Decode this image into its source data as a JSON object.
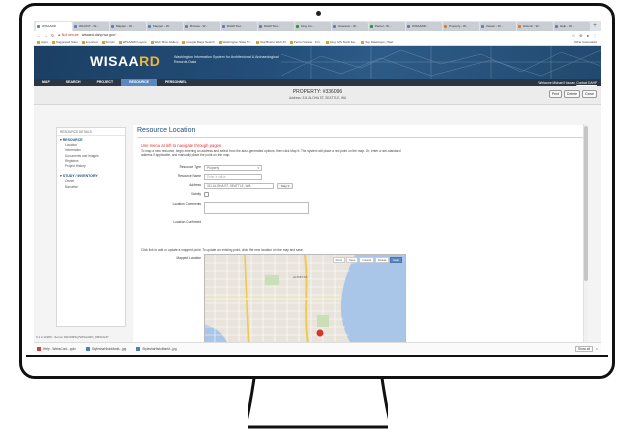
{
  "browser": {
    "tabs": [
      {
        "label": "WISAARD",
        "style": "active"
      },
      {
        "label": "WA DOT - W...",
        "style": ""
      },
      {
        "label": "Mapper - W...",
        "style": ""
      },
      {
        "label": "Mapper - W...",
        "style": ""
      },
      {
        "label": "Browse - W...",
        "style": ""
      },
      {
        "label": "DAHP Det...",
        "style": ""
      },
      {
        "label": "DAHP Det...",
        "style": ""
      },
      {
        "label": "King Co...",
        "style": "green"
      },
      {
        "label": "Assessor - W...",
        "style": ""
      },
      {
        "label": "Parcel - W...",
        "style": "green"
      },
      {
        "label": "WISAARD...",
        "style": ""
      },
      {
        "label": "Property - W...",
        "style": "orange"
      },
      {
        "label": "Viewer - W...",
        "style": ""
      },
      {
        "label": "Historic - W...",
        "style": "orange"
      },
      {
        "label": "Help - W...",
        "style": ""
      }
    ],
    "new_tab": "+",
    "nav": {
      "back": "←",
      "forward": "→",
      "reload": "↻"
    },
    "secure_label": "▲ Not secure",
    "url": "wisaard.dahp.wa.gov/",
    "addr_icons": {
      "star": "☆",
      "ext": "⊕",
      "account": "●",
      "menu": "⋮"
    },
    "bookmarks": [
      "Apps",
      "Suggested Sites",
      "Imported",
      "Scripts",
      "WISAARD Layers",
      "Web Slice Gallery",
      "Google Maps Search",
      "Washington State Tr...",
      "Teal Brains Web #1",
      "Parcel Viewer - Kin...",
      "King GIS North Ea...",
      "Top Data/Apps | Web"
    ],
    "bookmarks_right": "Other bookmarks"
  },
  "site": {
    "logo_main": "WISAA",
    "logo_accent": "RD",
    "tagline": "Washington Information System for Architectural & Archaeological Records Data",
    "nav": [
      "MAP",
      "SEARCH",
      "PROJECT",
      "RESOURCE",
      "PERSONNEL"
    ],
    "nav_active_index": 3,
    "welcome": "Welcome Michael Houser,",
    "welcome_link": "Contact DAHP"
  },
  "property": {
    "title": "PROPERTY: #336096",
    "address": "Address: 311 ALOHA ST, SEATTLE, WA",
    "buttons": [
      "Print",
      "Delete",
      "Close"
    ]
  },
  "left_panel": {
    "header": "RESOURCE DETAILS",
    "sections": [
      {
        "title": "▾ RESOURCE",
        "items": [
          "Location",
          "Information",
          "Documents and Images",
          "Registers",
          "Project History"
        ]
      },
      {
        "title": "▾ STUDY / INVENTORY",
        "items": [
          "Owner",
          "Narrative"
        ]
      }
    ]
  },
  "main": {
    "title": "Resource Location",
    "warning": "Use menu at left to navigate through pages",
    "intro": "To map a new resource, begin entering an address and select from the auto-generated options, then click Map It. The system will place a red point on the map. Or, enter a non-standard address if applicable, and manually place the point on the map.",
    "fields": {
      "resource_type_label": "Resource Type",
      "resource_type_value": "Property",
      "resource_name_label": "Resource Name",
      "resource_name_placeholder": "Enter a value",
      "address_label": "Address",
      "address_value": "311 ALOHA ST, SEATTLE, WA",
      "map_it_label": "Map It",
      "vicinity_label": "Vicinity",
      "location_comments_label": "Location Comments",
      "location_confirmed_label": "Location Confirmed"
    },
    "map_hint": "Click link to add or update a mapped point. To update an existing point, click the new location on the map and save.",
    "map_label": "Mapped Location",
    "map_tools": [
      "Point",
      "Save",
      "Cancel",
      "Delete",
      "Help"
    ],
    "map_active_tool": 4,
    "map_place": "ALTON ST"
  },
  "status_bar": "0.1.2.11989 - Server DEVDBSQ/WISAARD_DB/DAHP",
  "downloads": {
    "items": [
      "Help - WebsCont...pptx",
      "StyleshaHistoMarkt...jpg",
      "StyleshaHistoMarkt...jpg"
    ],
    "show_all": "Show all",
    "close": "×"
  },
  "colors": {
    "header_blue": "#1f4e79",
    "nav_dark": "#2a3644",
    "nav_active": "#5a87bf",
    "logo_accent": "#f2b632",
    "warning_red": "#e03030",
    "map_water": "#a9c6e8",
    "map_pin": "#d9342b"
  }
}
